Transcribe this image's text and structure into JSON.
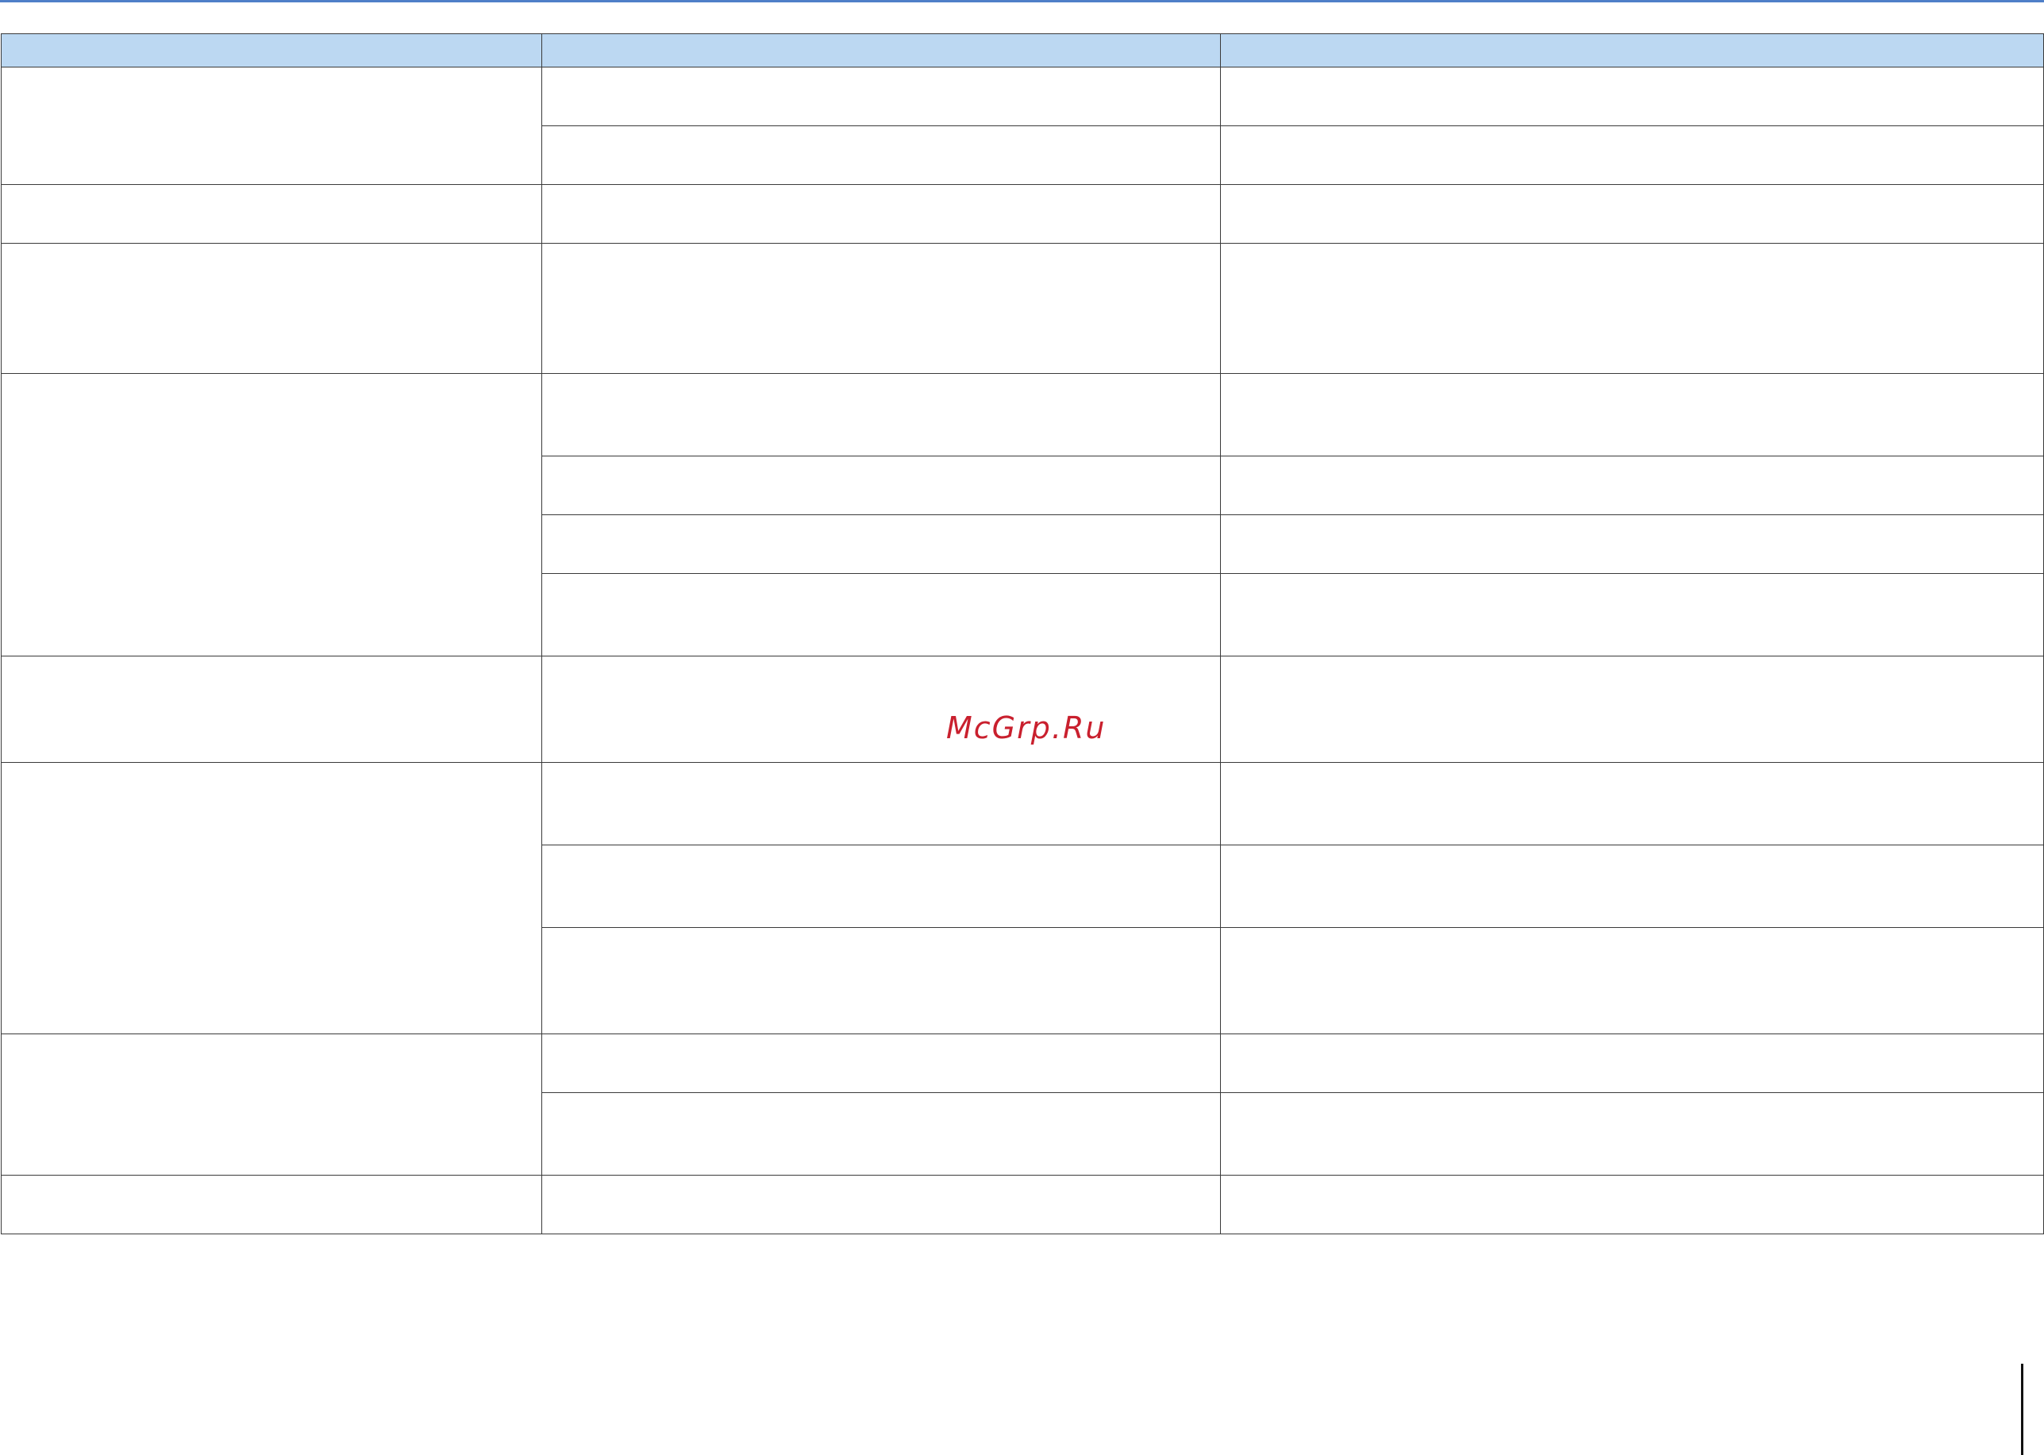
{
  "document": {
    "watermark": "McGrp.Ru",
    "colors": {
      "accent_rule": "#4f7fc8",
      "header_fill": "#bcd8f2",
      "watermark": "#c9202e",
      "grid_lines": "#3a3a3a"
    },
    "table": {
      "headers": [
        "",
        "",
        ""
      ],
      "groups": [
        {
          "col1": "",
          "rows": [
            {
              "col2": "",
              "col3": ""
            },
            {
              "col2": "",
              "col3": ""
            }
          ]
        },
        {
          "col1": "",
          "rows": [
            {
              "col2": "",
              "col3": ""
            }
          ]
        },
        {
          "col1": "",
          "rows": [
            {
              "col2": "",
              "col3": ""
            }
          ]
        },
        {
          "col1": "",
          "rows": [
            {
              "col2": "",
              "col3": ""
            },
            {
              "col2": "",
              "col3": ""
            },
            {
              "col2": "",
              "col3": ""
            },
            {
              "col2": "",
              "col3": ""
            }
          ]
        },
        {
          "col1": "",
          "rows": [
            {
              "col2": "",
              "col3": ""
            }
          ]
        },
        {
          "col1": "",
          "rows": [
            {
              "col2": "",
              "col3": ""
            },
            {
              "col2": "",
              "col3": ""
            },
            {
              "col2": "",
              "col3": ""
            }
          ]
        },
        {
          "col1": "",
          "rows": [
            {
              "col2": "",
              "col3": ""
            },
            {
              "col2": "",
              "col3": ""
            }
          ]
        },
        {
          "col1": "",
          "rows": [
            {
              "col2": "",
              "col3": ""
            }
          ]
        }
      ]
    }
  }
}
